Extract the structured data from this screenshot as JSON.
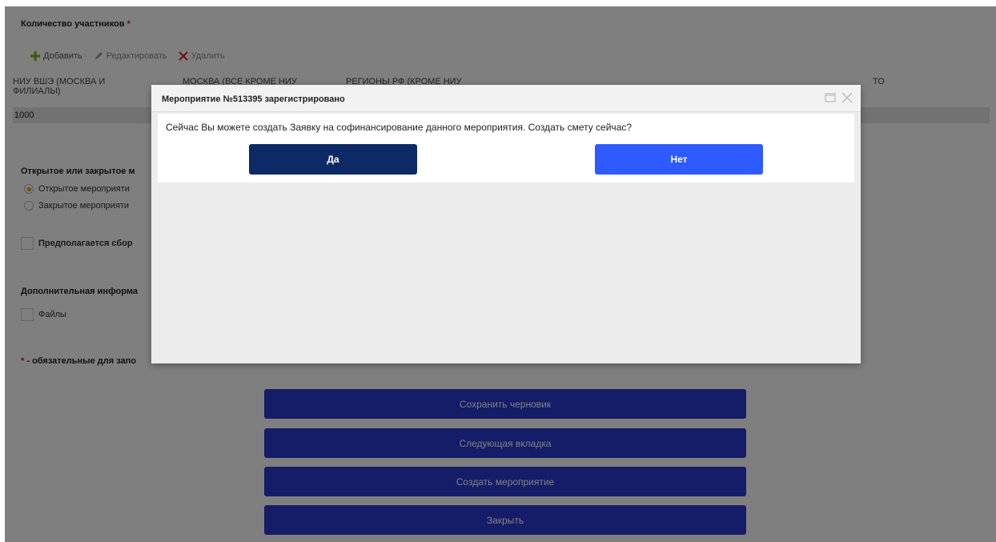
{
  "form": {
    "participants_label": "Количество участников",
    "required_mark": "*",
    "toolbar": {
      "add": "Добавить",
      "edit": "Редактировать",
      "delete": "Удалить"
    },
    "grid": {
      "columns": [
        "НИУ ВШЭ (МОСКВА И ФИЛИАЛЫ)",
        "МОСКВА (ВСЕ КРОМЕ НИУ",
        "РЕГИОНЫ РФ (КРОМЕ НИУ",
        "ТО"
      ],
      "rows": [
        [
          "1000"
        ]
      ]
    },
    "open_closed_label": "Открытое или закрытое м",
    "radio_open": "Открытое мероприяти",
    "radio_closed": "Закрытое мероприяти",
    "collect_label": "Предполагается сбор",
    "additional_info_label": "Дополнительная информа",
    "files_label": "Файлы",
    "required_note": "- обязательные для запо"
  },
  "actions": {
    "save_draft": "Сохранить черновик",
    "next_tab": "Следующая вкладка",
    "create_event": "Создать мероприятие",
    "close": "Закрыть"
  },
  "modal": {
    "title": "Мероприятие №513395 зарегистрировано",
    "message": "Сейчас Вы можете создать Заявку на софинансирование данного мероприятия. Создать смету сейчас?",
    "yes": "Да",
    "no": "Нет"
  },
  "colors": {
    "primary_button": "#2b3bd1",
    "yes_button": "#0e2a66",
    "no_button": "#2d5bff",
    "required": "#d9231d"
  }
}
